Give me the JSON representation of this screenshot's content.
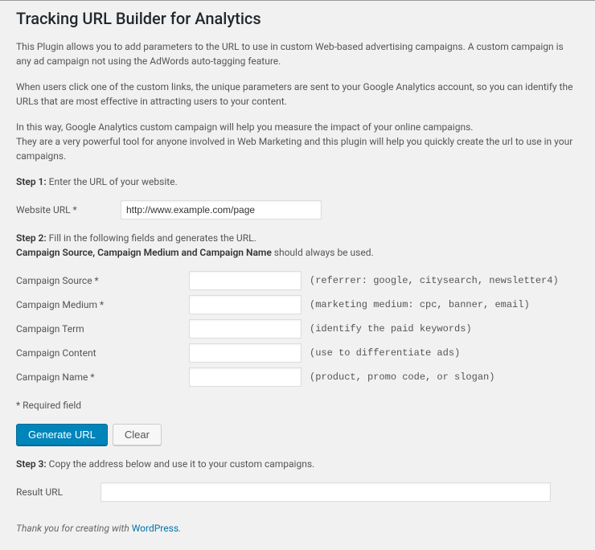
{
  "header": {
    "title": "Tracking URL Builder for Analytics"
  },
  "intro": {
    "p1": "This Plugin allows you to add parameters to the URL to use in custom Web-based advertising campaigns. A custom campaign is any ad campaign not using the AdWords auto-tagging feature.",
    "p2": "When users click one of the custom links, the unique parameters are sent to your Google Analytics account, so you can identify the URLs that are most effective in attracting users to your content.",
    "p3a": "In this way, Google Analytics custom campaign will help you measure the impact of your online campaigns.",
    "p3b": "They are a very powerful tool for anyone involved in Web Marketing and this plugin will help you quickly create the url to use in your campaigns."
  },
  "step1": {
    "label": "Step 1:",
    "text": " Enter the URL of your website.",
    "field_label": "Website URL *",
    "value": "http://www.example.com/page"
  },
  "step2": {
    "label": "Step 2:",
    "text": " Fill in the following fields and generates the URL.",
    "bold_text": "Campaign Source, Campaign Medium and Campaign Name",
    "rest_text": " should always be used.",
    "fields": [
      {
        "label": "Campaign Source *",
        "value": "",
        "hint": "(referrer: google, citysearch, newsletter4)"
      },
      {
        "label": "Campaign Medium *",
        "value": "",
        "hint": "(marketing medium: cpc, banner, email)"
      },
      {
        "label": "Campaign Term",
        "value": "",
        "hint": "(identify the paid keywords)"
      },
      {
        "label": "Campaign Content",
        "value": "",
        "hint": "(use to differentiate ads)"
      },
      {
        "label": "Campaign Name *",
        "value": "",
        "hint": "(product, promo code, or slogan)"
      }
    ],
    "required_note": "* Required field"
  },
  "buttons": {
    "generate": "Generate URL",
    "clear": "Clear"
  },
  "step3": {
    "label": "Step 3:",
    "text": " Copy the address below and use it to your custom campaigns.",
    "field_label": "Result URL",
    "value": ""
  },
  "footer": {
    "prefix": "Thank you for creating with ",
    "link": "WordPress",
    "suffix": "."
  }
}
